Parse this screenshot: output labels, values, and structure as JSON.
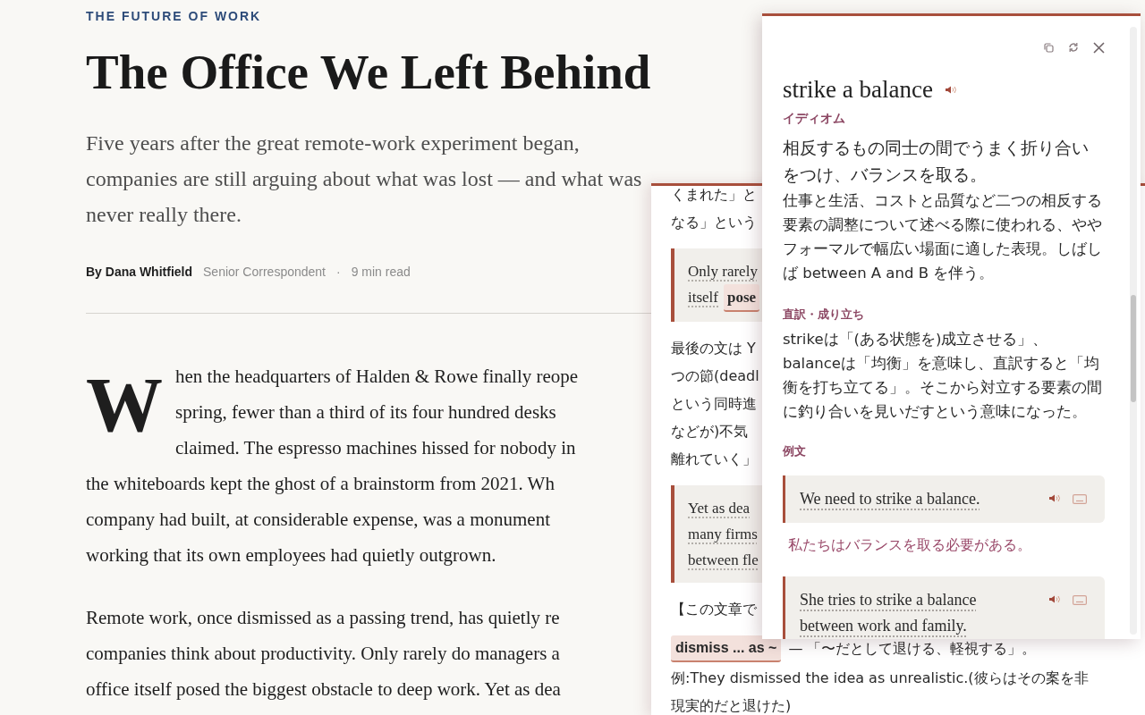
{
  "article": {
    "kicker": "THE FUTURE OF WORK",
    "title": "The Office We Left Behind",
    "dek_lines": [
      "Five years after the great remote-work experiment began,",
      "companies are still arguing about what was lost — and what was",
      "never really there."
    ],
    "byline": {
      "author": "By Dana Whitfield",
      "role": "Senior Correspondent",
      "separator": "·",
      "read_time": "9 min read"
    },
    "paragraphs": [
      {
        "drop_cap": "W",
        "lines": [
          "hen the headquarters of Halden & Rowe finally reope",
          "spring, fewer than a third of its four hundred desks",
          "claimed. The espresso machines hissed for nobody in",
          "the whiteboards kept the ghost of a brainstorm from 2021. Wh",
          "company had built, at considerable expense, was a monument",
          "working that its own employees had quietly outgrown."
        ]
      },
      {
        "lines": [
          "Remote work, once dismissed as a passing trend, has quietly re",
          "companies think about productivity. Only rarely do managers a",
          "office itself posed the biggest obstacle to deep work. Yet as dea"
        ]
      }
    ]
  },
  "notes_panel": {
    "items": [
      {
        "kind": "text",
        "lines": [
          "くまれた」と",
          "なる」という"
        ]
      },
      {
        "kind": "quote",
        "lines": [
          [
            {
              "text": "Only rarely",
              "highlighted": false
            }
          ],
          [
            {
              "text": "itself",
              "highlighted": false
            },
            {
              "text": "pose",
              "highlighted": true
            }
          ]
        ]
      },
      {
        "kind": "text",
        "lines": [
          "最後の文は Y",
          "つの節(deadl",
          "という同時進",
          "などが)不気",
          "離れていく」"
        ]
      },
      {
        "kind": "quote",
        "lines": [
          [
            {
              "text": "Yet as dea",
              "highlighted": false
            }
          ],
          [
            {
              "text": "many firms",
              "highlighted": false
            }
          ],
          [
            {
              "text": "between fle",
              "highlighted": false
            }
          ]
        ]
      },
      {
        "kind": "text",
        "lines": [
          "【この文章で"
        ]
      },
      {
        "kind": "term",
        "term": "dismiss ... as ~",
        "gloss": "— 「〜だとして退ける、軽視する」。"
      },
      {
        "kind": "text",
        "lines": [
          "例:They dismissed the idea as unrealistic.(彼らはその案を非",
          "現実的だと退けた)"
        ]
      }
    ]
  },
  "definition_popup": {
    "headword": "strike a balance",
    "part_of_speech": "イディオム",
    "definition": "相反するもの同士の間でうまく折り合いをつけ、バランスを取る。",
    "usage": "仕事と生活、コストと品質など二つの相反する要素の調整について述べる際に使われる、ややフォーマルで幅広い場面に適した表現。しばしば between A and B を伴う。",
    "sections": [
      {
        "heading": "直訳・成り立ち",
        "body": "strikeは「(ある状態を)成立させる」、balanceは「均衡」を意味し、直訳すると「均衡を打ち立てる」。そこから対立する要素の間に釣り合いを見いだすという意味になった。"
      }
    ],
    "examples_heading": "例文",
    "examples": [
      {
        "sentence_lines": [
          "We need to strike a balance."
        ],
        "translation": "私たちはバランスを取る必要がある。"
      },
      {
        "sentence_lines": [
          "She tries to strike a balance",
          "between work and family."
        ]
      }
    ]
  }
}
